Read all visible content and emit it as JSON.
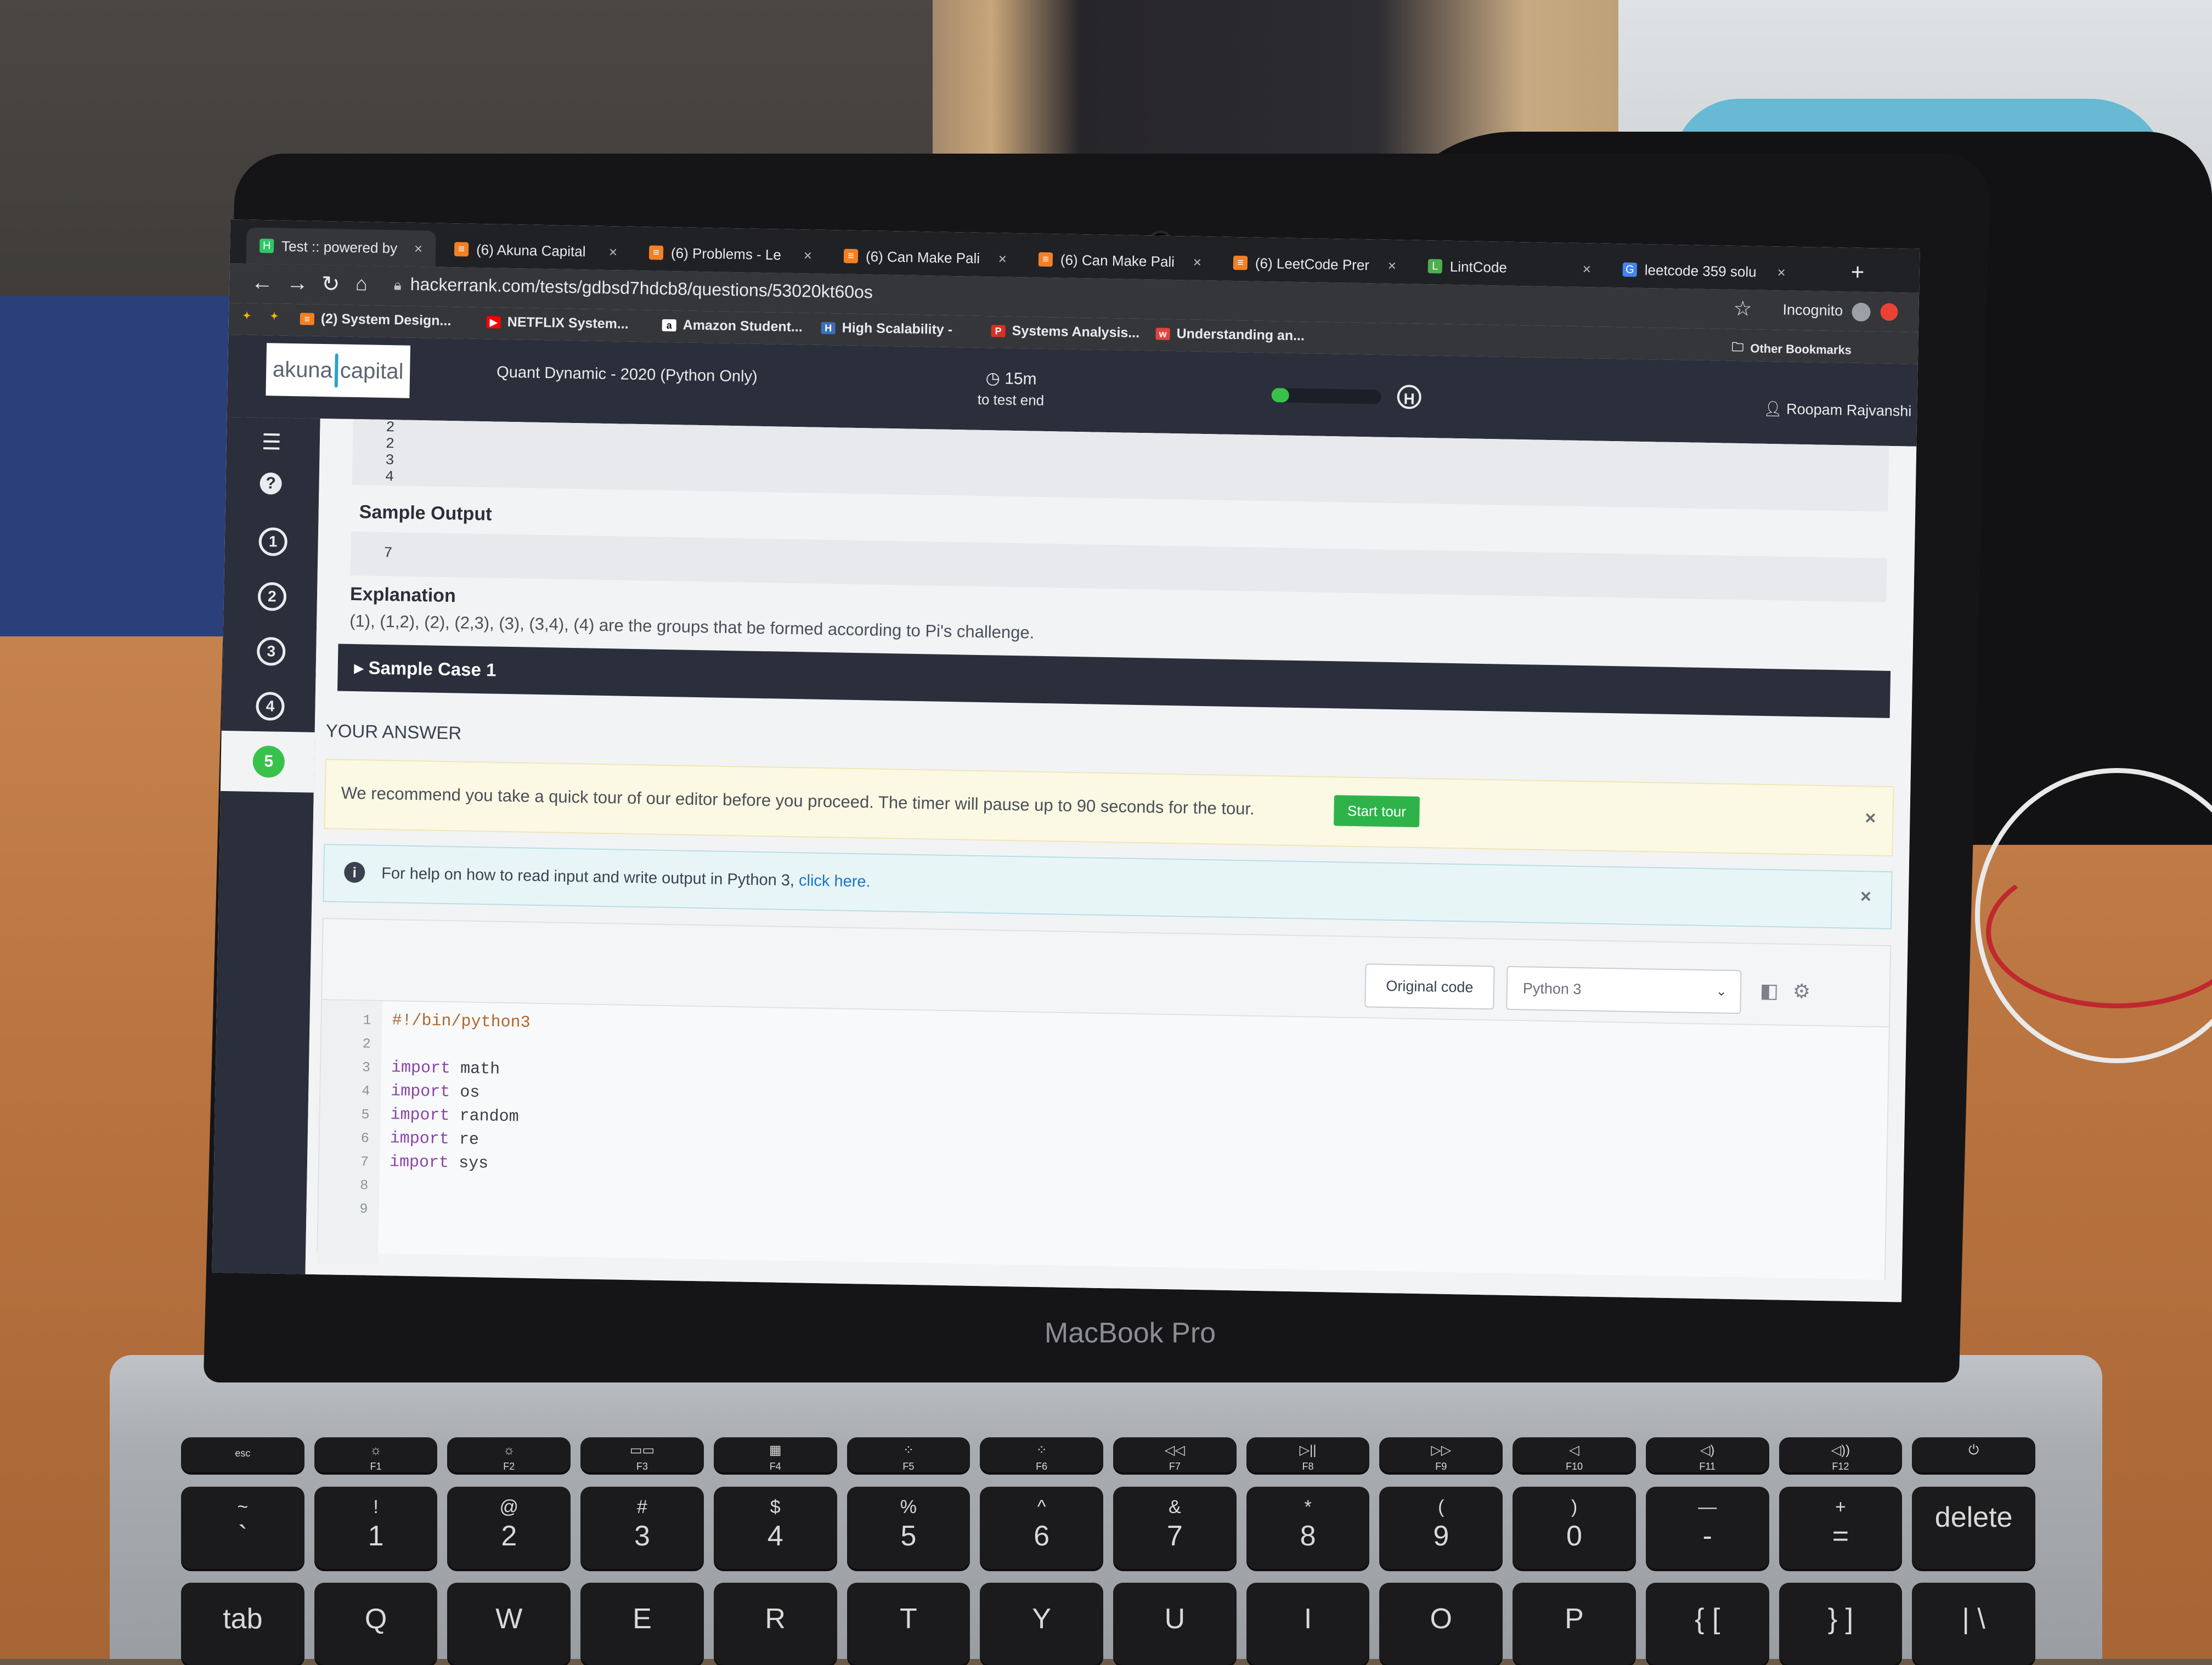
{
  "browser": {
    "tabs": [
      {
        "title": "Test :: powered by",
        "active": true,
        "favicon": "hackerrank-icon"
      },
      {
        "title": "(6) Akuna Capital",
        "favicon": "stack-overflow-icon"
      },
      {
        "title": "(6) Problems - Le",
        "favicon": "stack-overflow-icon"
      },
      {
        "title": "(6) Can Make Pali",
        "favicon": "stack-overflow-icon"
      },
      {
        "title": "(6) Can Make Pali",
        "favicon": "stack-overflow-icon"
      },
      {
        "title": "(6) LeetCode Prer",
        "favicon": "stack-overflow-icon"
      },
      {
        "title": "LintCode",
        "favicon": "lintcode-icon"
      },
      {
        "title": "leetcode 359 solu",
        "favicon": "google-icon"
      }
    ],
    "new_tab": "+",
    "url": "hackerrank.com/tests/gdbsd7hdcb8/questions/53020kt60os",
    "profile_label": "Incognito",
    "other_bookmarks": "Other Bookmarks",
    "bookmarks": [
      {
        "label": "",
        "icon": "star-apps-icon"
      },
      {
        "label": "",
        "icon": "star-apps-icon"
      },
      {
        "label": "(2) System Design...",
        "icon": "stack-overflow-icon"
      },
      {
        "label": "NETFLIX System...",
        "icon": "youtube-icon"
      },
      {
        "label": "Amazon Student...",
        "icon": "amazon-icon"
      },
      {
        "label": "High Scalability -",
        "icon": "hs-icon"
      },
      {
        "label": "Systems Analysis...",
        "icon": "pdf-icon"
      },
      {
        "label": "Understanding an...",
        "icon": "web-icon"
      }
    ]
  },
  "header": {
    "logo_left": "akuna",
    "logo_right": "capital",
    "test_name": "Quant Dynamic - 2020 (Python Only)",
    "timer_value": "15m",
    "timer_caption": "to test end",
    "progress_fraction": 0.16,
    "user_name": "Roopam Rajvanshi"
  },
  "rail": {
    "questions": [
      "1",
      "2",
      "3",
      "4",
      "5"
    ],
    "active_question": "5"
  },
  "problem": {
    "sample_input_tail": [
      "2",
      "2",
      "3",
      "4"
    ],
    "sample_output_heading": "Sample Output",
    "sample_output_value": "7",
    "explanation_heading": "Explanation",
    "explanation_text": "(1), (1,2), (2), (2,3), (3), (3,4), (4) are the groups that be formed according to Pi's challenge.",
    "sample_case_label": "Sample Case 1"
  },
  "answer": {
    "heading": "YOUR ANSWER",
    "tour_text": "We recommend you take a quick tour of our editor before you proceed. The timer will pause up to 90 seconds for the tour.",
    "tour_button": "Start tour",
    "help_text": "For help on how to read input and write output in Python 3,",
    "help_link": "click here.",
    "close_symbol": "×",
    "original_code_button": "Original code",
    "language": "Python 3",
    "code_lines": [
      {
        "n": "1",
        "text": "#!/bin/python3"
      },
      {
        "n": "2",
        "text": ""
      },
      {
        "n": "3",
        "kw": "import",
        "rest": " math"
      },
      {
        "n": "4",
        "kw": "import",
        "rest": " os"
      },
      {
        "n": "5",
        "kw": "import",
        "rest": " random"
      },
      {
        "n": "6",
        "kw": "import",
        "rest": " re"
      },
      {
        "n": "7",
        "kw": "import",
        "rest": " sys"
      },
      {
        "n": "8",
        "text": ""
      },
      {
        "n": "9",
        "text": ""
      }
    ]
  },
  "laptop": {
    "model_label": "MacBook Pro",
    "keys_fn": [
      {
        "top": "",
        "main": "esc"
      },
      {
        "top": "☼",
        "main": "F1"
      },
      {
        "top": "☼",
        "main": "F2"
      },
      {
        "top": "▭▭",
        "main": "F3"
      },
      {
        "top": "▦",
        "main": "F4"
      },
      {
        "top": "⁘",
        "main": "F5"
      },
      {
        "top": "⁘",
        "main": "F6"
      },
      {
        "top": "◁◁",
        "main": "F7"
      },
      {
        "top": "▷||",
        "main": "F8"
      },
      {
        "top": "▷▷",
        "main": "F9"
      },
      {
        "top": "◁",
        "main": "F10"
      },
      {
        "top": "◁)",
        "main": "F11"
      },
      {
        "top": "◁))",
        "main": "F12"
      },
      {
        "top": "⏻",
        "main": ""
      }
    ],
    "keys_num": [
      {
        "top": "~",
        "main": "`"
      },
      {
        "top": "!",
        "main": "1"
      },
      {
        "top": "@",
        "main": "2"
      },
      {
        "top": "#",
        "main": "3"
      },
      {
        "top": "$",
        "main": "4"
      },
      {
        "top": "%",
        "main": "5"
      },
      {
        "top": "^",
        "main": "6"
      },
      {
        "top": "&",
        "main": "7"
      },
      {
        "top": "*",
        "main": "8"
      },
      {
        "top": "(",
        "main": "9"
      },
      {
        "top": ")",
        "main": "0"
      },
      {
        "top": "—",
        "main": "-"
      },
      {
        "top": "+",
        "main": "="
      },
      {
        "top": "",
        "main": "delete"
      }
    ],
    "keys_qwerty": [
      "tab",
      "Q",
      "W",
      "E",
      "R",
      "T",
      "Y",
      "U",
      "I",
      "O",
      "P",
      "{ [",
      "} ]",
      "| \\"
    ]
  }
}
